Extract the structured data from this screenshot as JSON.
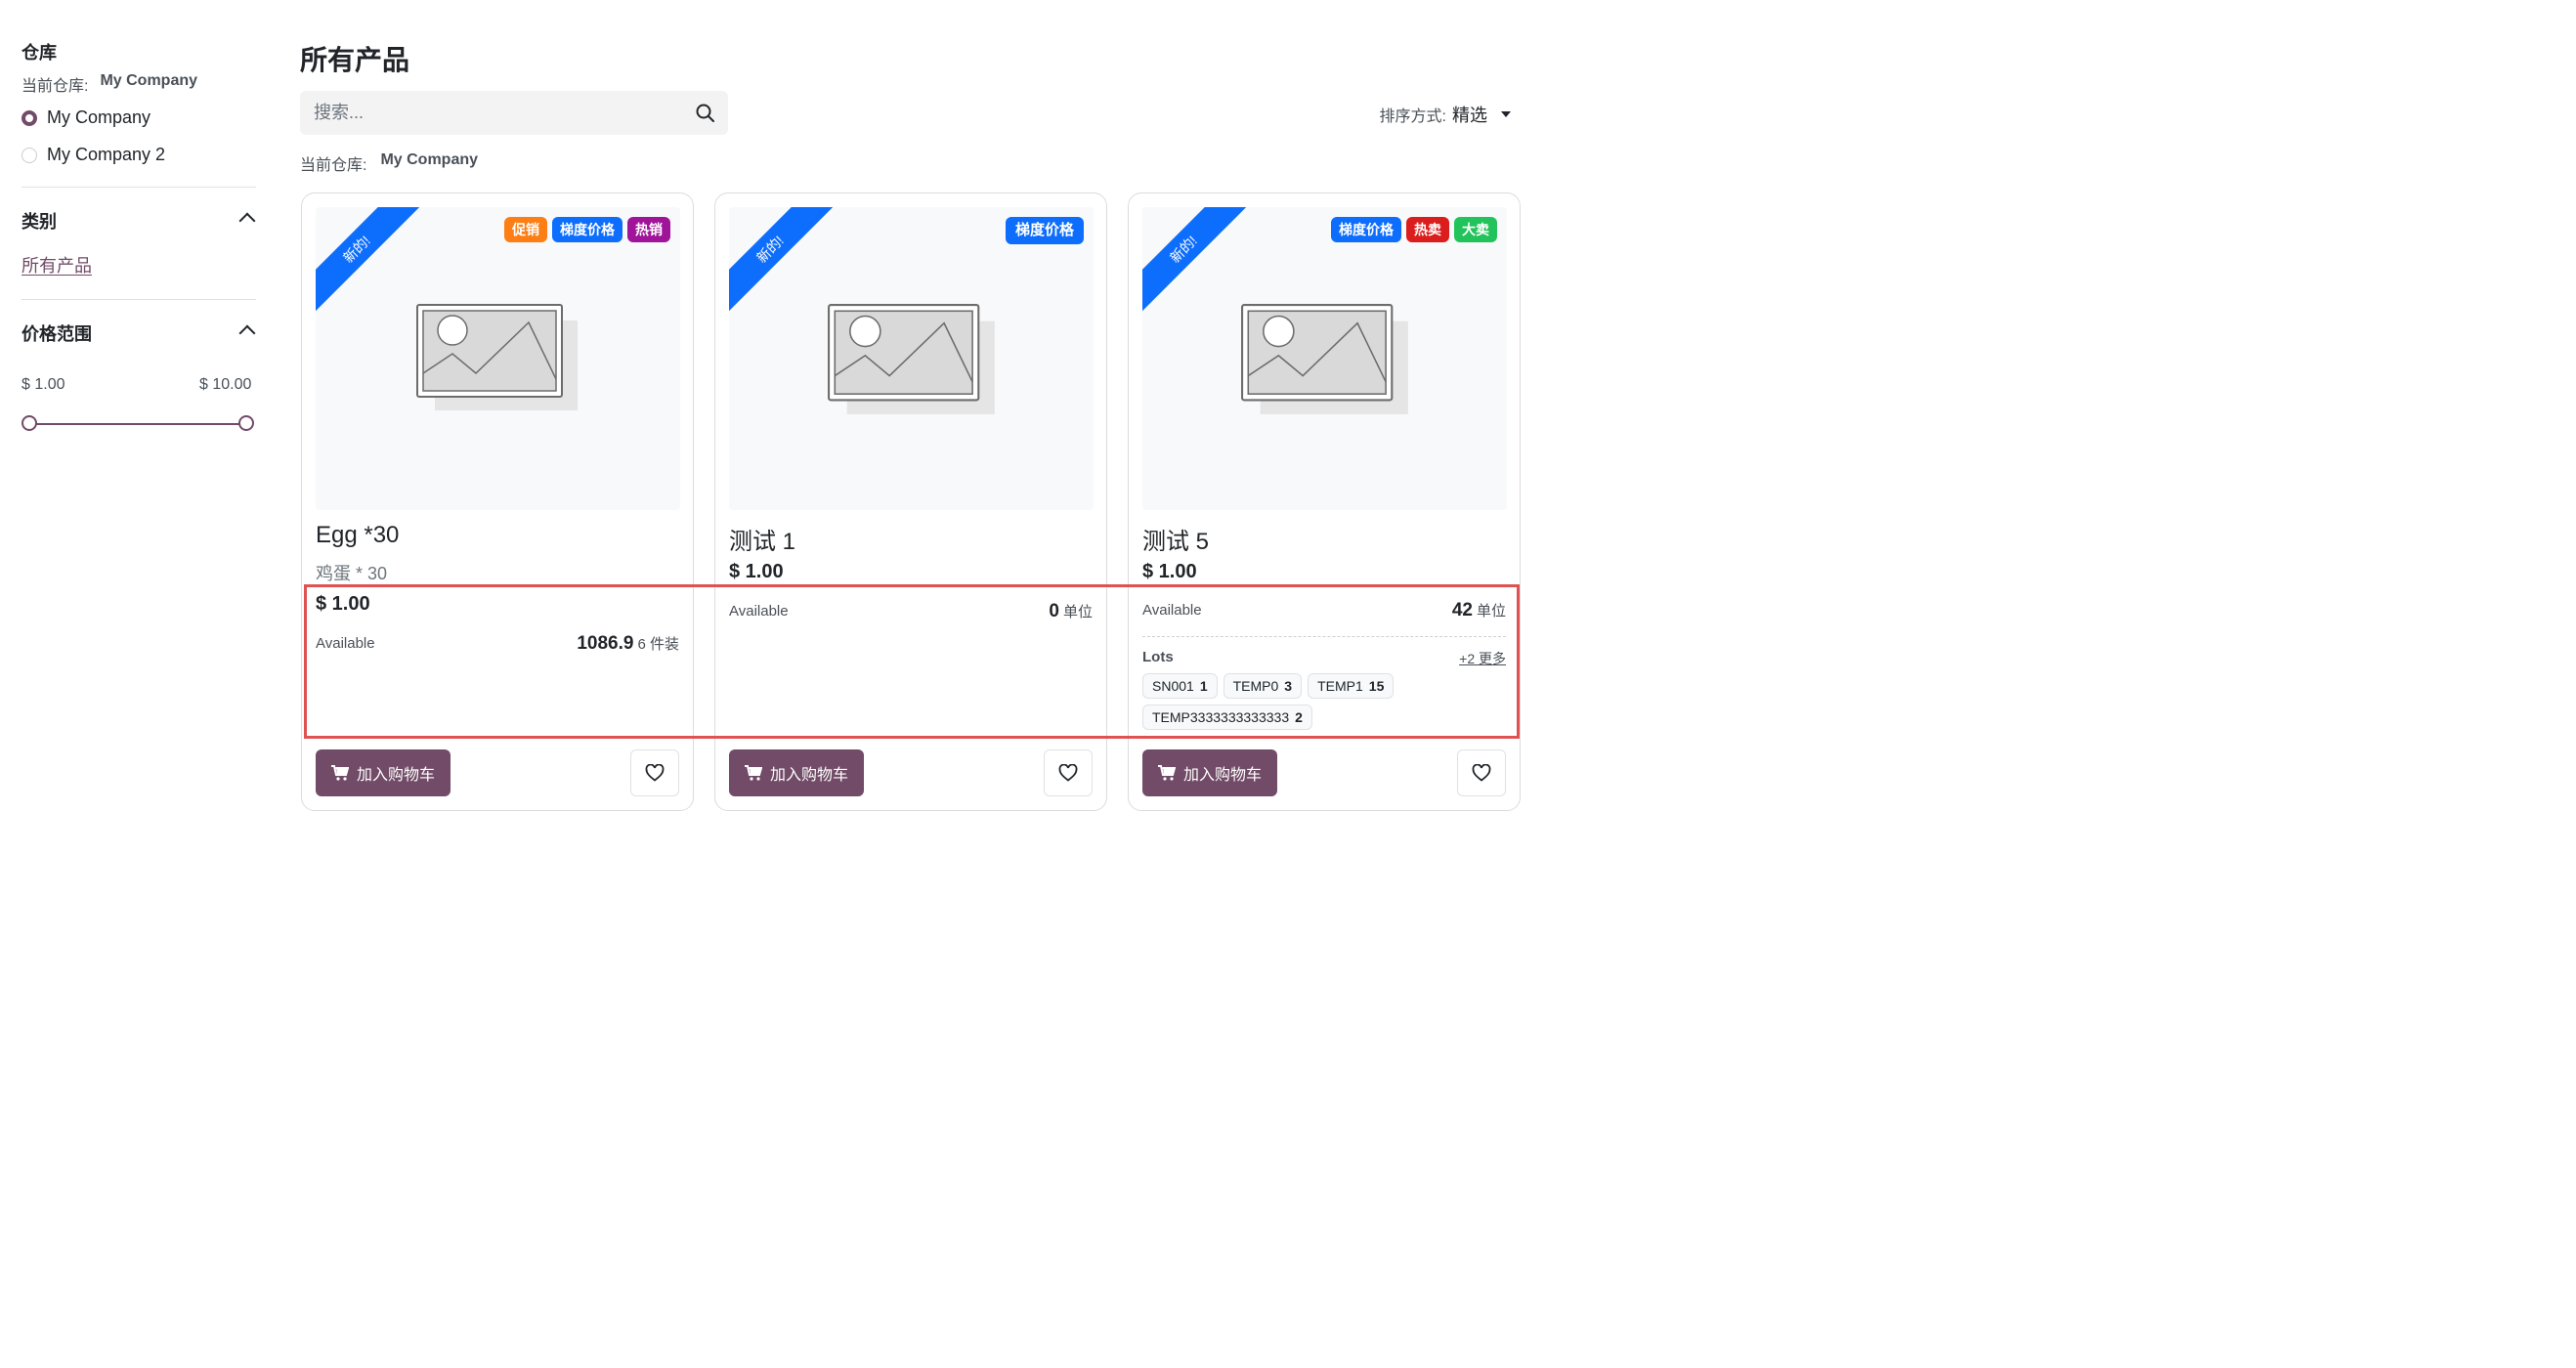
{
  "colors": {
    "brand": "#714b67",
    "ribbon": "#0d6efd",
    "highlight": "#e05252",
    "badge_orange": "#fd7e14",
    "badge_blue": "#0d6efd",
    "badge_purple": "#a0149a",
    "badge_red": "#dc1d1d",
    "badge_green": "#22c35a"
  },
  "sidebar": {
    "warehouse": {
      "title": "仓库",
      "current_label": "当前仓库:",
      "current_value": "My Company",
      "options": [
        {
          "label": "My Company",
          "checked": true
        },
        {
          "label": "My Company 2",
          "checked": false
        }
      ]
    },
    "category": {
      "title": "类别",
      "items": [
        "所有产品"
      ]
    },
    "price_range": {
      "title": "价格范围",
      "min_label": "$ 1.00",
      "max_label": "$ 10.00"
    }
  },
  "header": {
    "title": "所有产品",
    "search_placeholder": "搜索...",
    "sort_label": "排序方式:",
    "sort_value": "精选",
    "current_label": "当前仓库:",
    "current_value": "My Company"
  },
  "products": [
    {
      "ribbon": "新的!",
      "badges": [
        {
          "label": "促销",
          "color": "#fd7e14"
        },
        {
          "label": "梯度价格",
          "color": "#0d6efd"
        },
        {
          "label": "热销",
          "color": "#a0149a"
        }
      ],
      "name": "Egg *30",
      "subtitle": "鸡蛋 * 30",
      "price": "$ 1.00",
      "available_label": "Available",
      "available_qty": "1086.9",
      "available_unit": "6 件装",
      "cart_label": "加入购物车"
    },
    {
      "ribbon": "新的!",
      "badges": [
        {
          "label": "梯度价格",
          "color": "#0d6efd"
        }
      ],
      "name": "测试 1",
      "price": "$ 1.00",
      "available_label": "Available",
      "available_qty": "0",
      "available_unit": "单位",
      "cart_label": "加入购物车"
    },
    {
      "ribbon": "新的!",
      "badges": [
        {
          "label": "梯度价格",
          "color": "#0d6efd"
        },
        {
          "label": "热卖",
          "color": "#dc1d1d"
        },
        {
          "label": "大卖",
          "color": "#22c35a"
        }
      ],
      "name": "测试 5",
      "price": "$ 1.00",
      "available_label": "Available",
      "available_qty": "42",
      "available_unit": "单位",
      "lots_label": "Lots",
      "more_label": "+2 更多",
      "lots": [
        {
          "name": "SN001",
          "qty": "1"
        },
        {
          "name": "TEMP0",
          "qty": "3"
        },
        {
          "name": "TEMP1",
          "qty": "15"
        },
        {
          "name": "TEMP3333333333333",
          "qty": "2"
        }
      ],
      "cart_label": "加入购物车"
    }
  ]
}
